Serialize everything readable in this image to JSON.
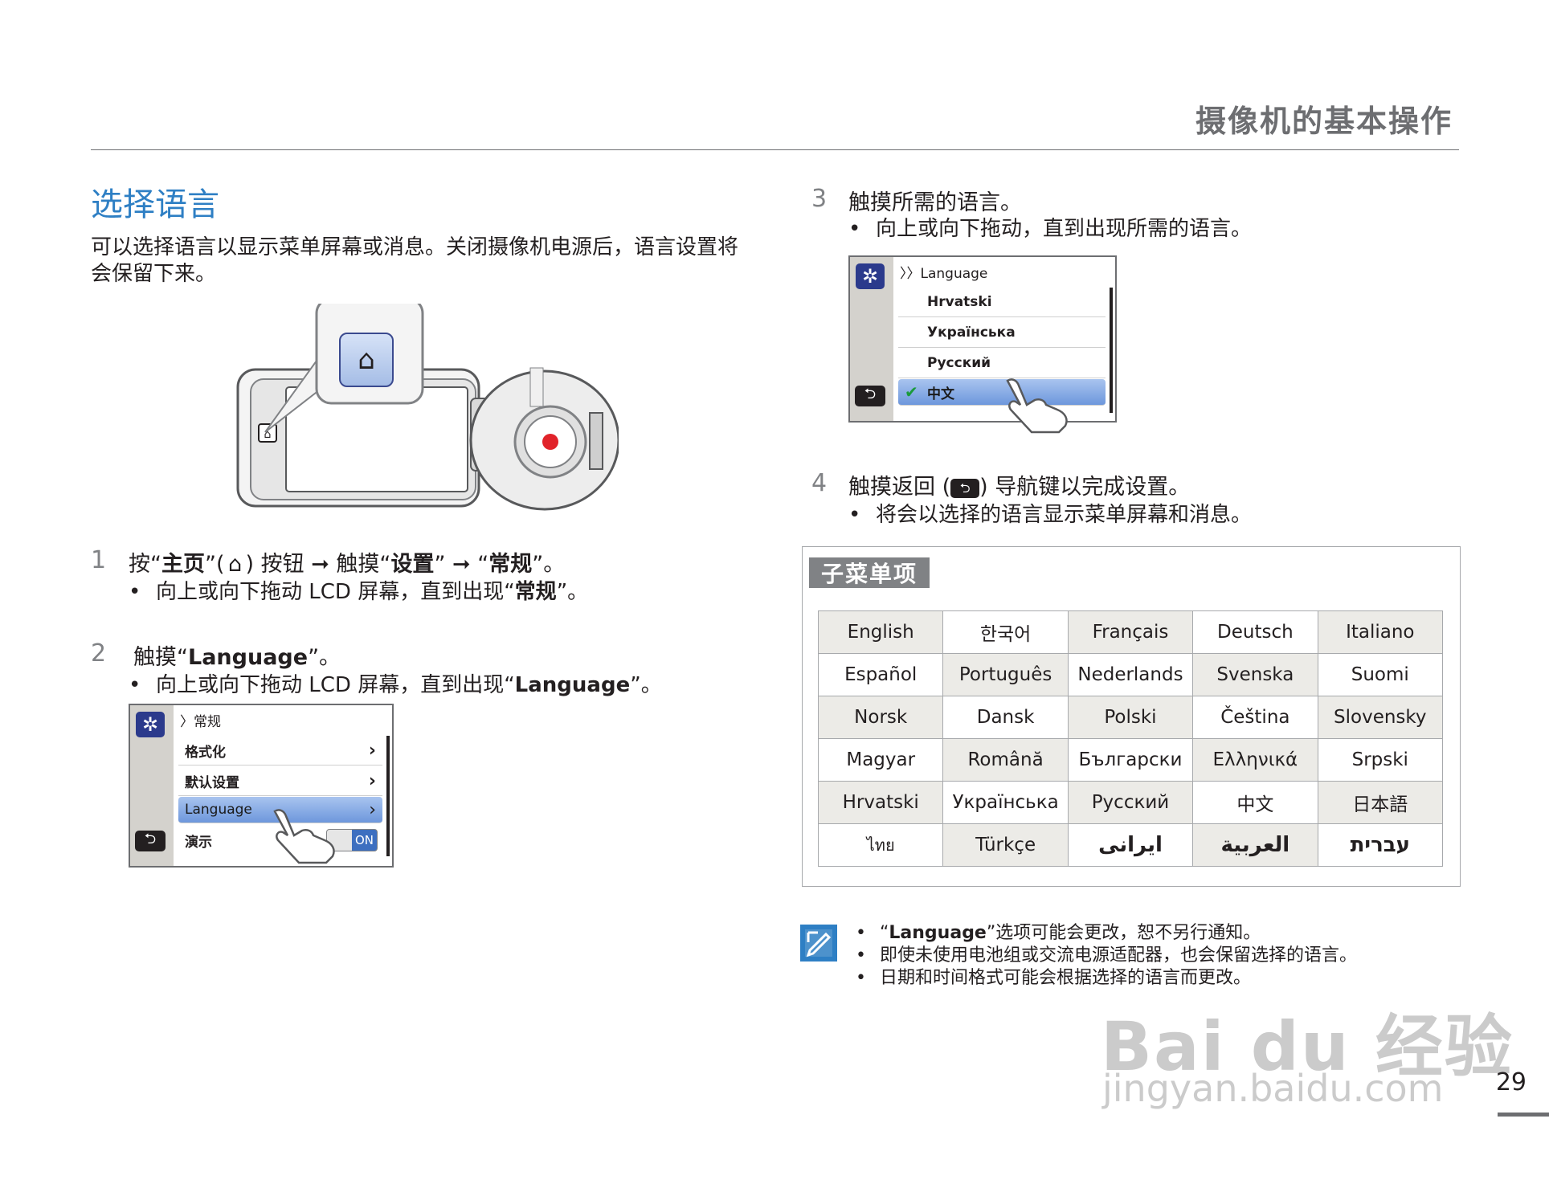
{
  "header": {
    "title": "摄像机的基本操作"
  },
  "section": {
    "title": "选择语言",
    "intro": "可以选择语言以显示菜单屏幕或消息。关闭摄像机电源后，语言设置将会保留下来。"
  },
  "steps": [
    {
      "num": "1",
      "parts": [
        "按“",
        "主页",
        "”(",
        ") 按钮 ➞ 触摸“",
        "设置",
        "” ➞ “",
        "常规",
        "”。"
      ],
      "bullet": [
        "向上或向下拖动 LCD 屏幕，直到出现“",
        "常规",
        "”。"
      ]
    },
    {
      "num": "2",
      "parts": [
        "触摸“",
        "Language",
        "”。"
      ],
      "bullet": [
        "向上或向下拖动 LCD 屏幕，直到出现“",
        "Language",
        "”。"
      ]
    },
    {
      "num": "3",
      "text": "触摸所需的语言。",
      "bullet": "向上或向下拖动，直到出现所需的语言。"
    },
    {
      "num": "4",
      "parts": [
        "触摸返回 (",
        ") 导航键以完成设置。"
      ],
      "bullet": "将会以选择的语言显示菜单屏幕和消息。"
    }
  ],
  "lcd_general": {
    "crumb": "〉常规",
    "items": [
      "格式化",
      "默认设置",
      "Language",
      "演示"
    ],
    "toggle": "ON"
  },
  "lcd_language": {
    "crumb": "〉〉Language",
    "items": [
      "Hrvatski",
      "Українська",
      "Русский",
      "中文"
    ]
  },
  "submenu": {
    "title": "子菜单项",
    "rows": [
      [
        "English",
        "한국어",
        "Français",
        "Deutsch",
        "Italiano"
      ],
      [
        "Español",
        "Português",
        "Nederlands",
        "Svenska",
        "Suomi"
      ],
      [
        "Norsk",
        "Dansk",
        "Polski",
        "Čeština",
        "Slovensky"
      ],
      [
        "Magyar",
        "Română",
        "Български",
        "Ελληνικά",
        "Srpski"
      ],
      [
        "Hrvatski",
        "Українська",
        "Русский",
        "中文",
        "日本語"
      ],
      [
        "ไทย",
        "Türkçe",
        "ایرانی",
        "العربية",
        "עברית"
      ]
    ]
  },
  "notes": [
    [
      "“",
      "Language",
      "”选项可能会更改，恕不另行通知。"
    ],
    "即使未使用电池组或交流电源适配器，也会保留选择的语言。",
    "日期和时间格式可能会根据选择的语言而更改。"
  ],
  "page_number": "29",
  "watermark": {
    "main": "Bai du 经验",
    "sub": "jingyan.baidu.com"
  },
  "colors": {
    "accent": "#2e7fc4",
    "gray": "#6d6e71",
    "selection": "#6d97dc"
  }
}
